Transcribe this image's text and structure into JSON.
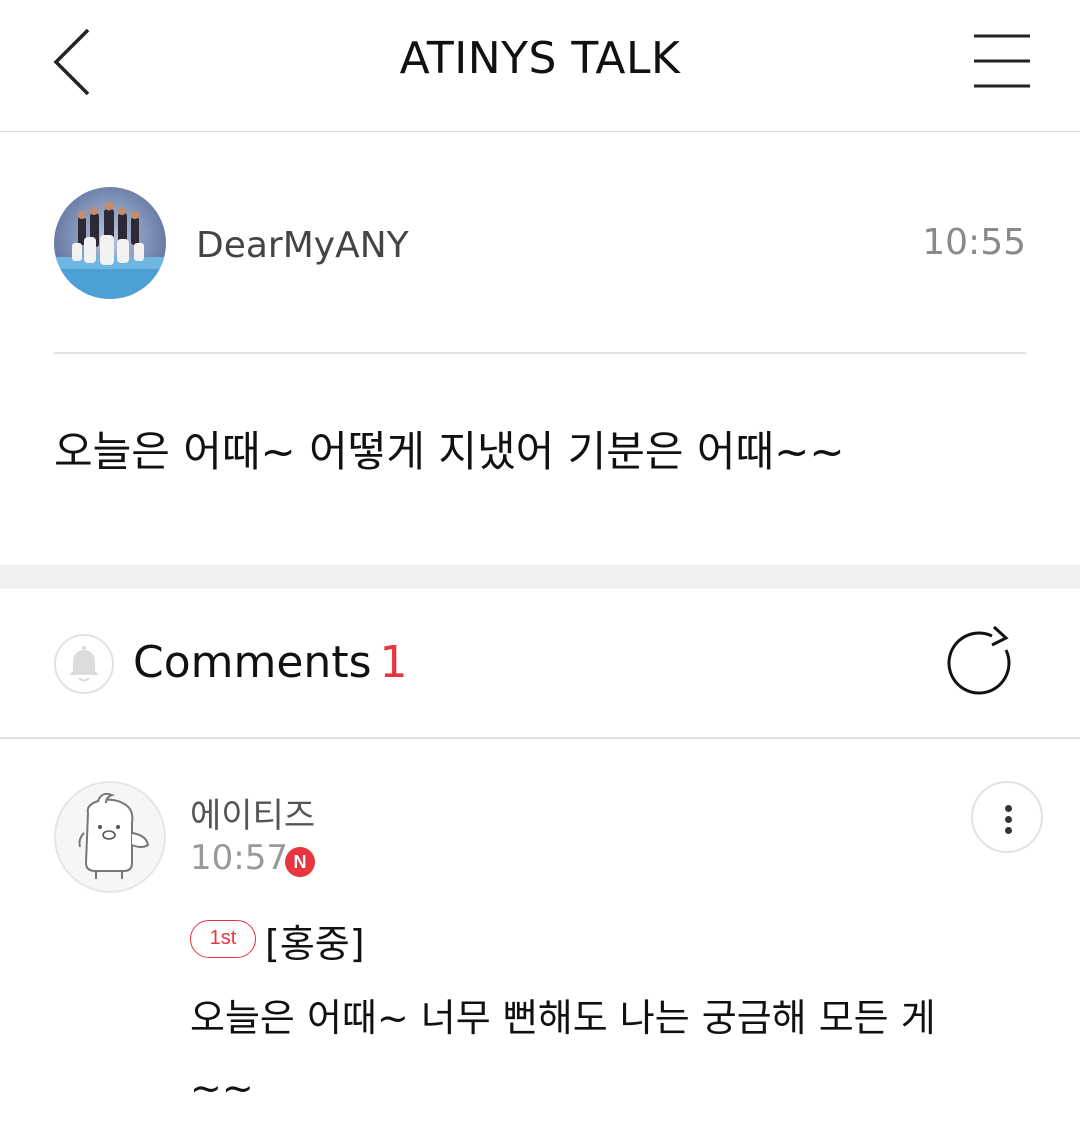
{
  "header": {
    "title": "ATINYS TALK",
    "back_icon": "chevron-left-icon",
    "menu_icon": "hamburger-menu-icon"
  },
  "post": {
    "author": "DearMyANY",
    "time": "10:55",
    "body": "오늘은 어때~ 어떻게 지냈어 기분은 어때~~"
  },
  "comments_section": {
    "label": "Comments",
    "count": "1",
    "bell_icon": "bell-icon",
    "refresh_icon": "refresh-icon"
  },
  "comments": [
    {
      "author": "에이티즈",
      "time": "10:57",
      "new_badge": "N",
      "rank_badge": "1st",
      "tag": "[홍중]",
      "text": "오늘은 어때~ 너무 뻔해도 나는 궁금해 모든 게~~"
    }
  ],
  "colors": {
    "accent": "#e8353f",
    "divider": "#e0e0e0",
    "section_gap": "#eeeff1"
  }
}
